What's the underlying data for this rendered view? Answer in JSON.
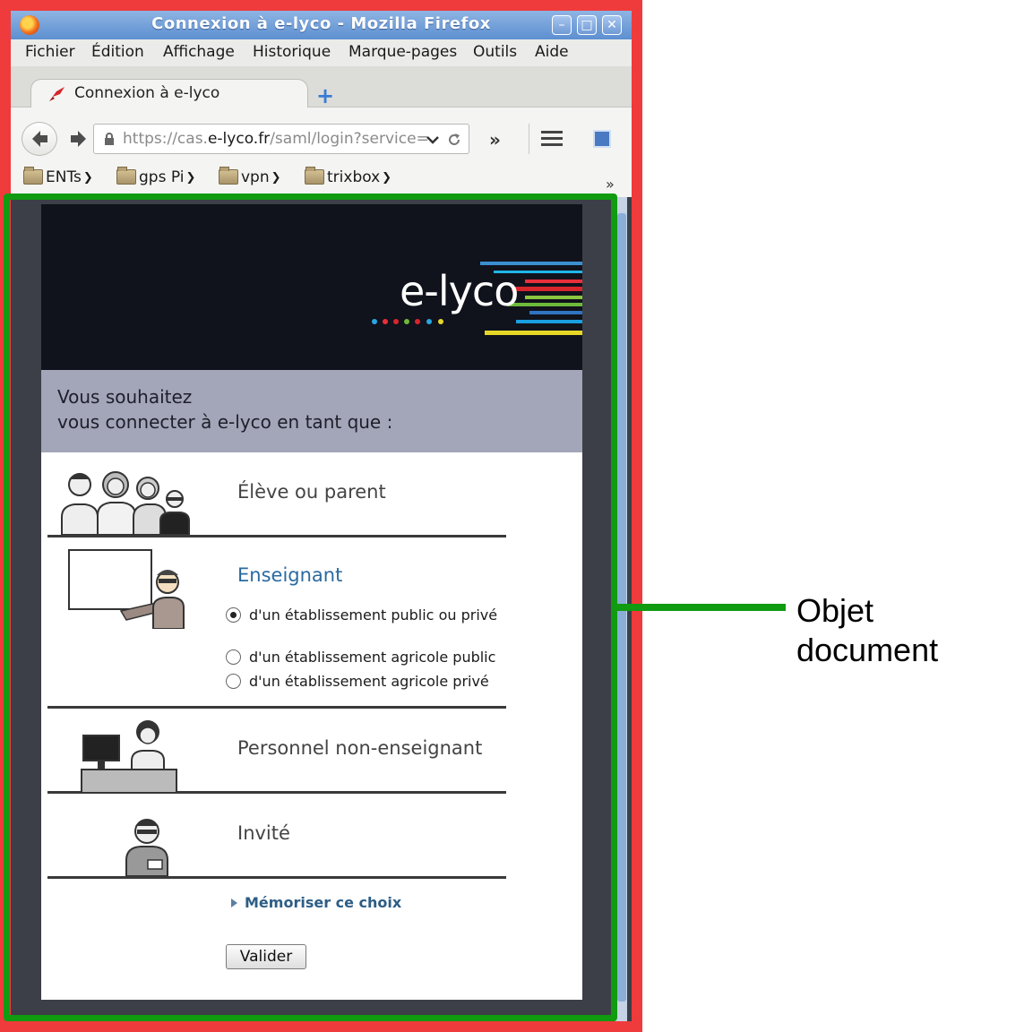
{
  "window": {
    "title": "Connexion à e-lyco - Mozilla Firefox",
    "controls": [
      "minimize",
      "maximize",
      "close"
    ]
  },
  "menubar": {
    "items": [
      "Fichier",
      "Édition",
      "Affichage",
      "Historique",
      "Marque-pages",
      "Outils",
      "Aide"
    ]
  },
  "tab": {
    "title": "Connexion à e-lyco",
    "new_tab": "+"
  },
  "navbar": {
    "url_prefix": "https://cas.",
    "url_domain": "e-lyco.fr",
    "url_suffix": "/saml/login?service=",
    "overflow": "»"
  },
  "bookmarks": {
    "items": [
      "ENTs",
      "gps Pi",
      "vpn",
      "trixbox"
    ],
    "more": "»"
  },
  "page": {
    "logo": "e-lyco",
    "question_line1": "Vous souhaitez",
    "question_line2": "vous connecter à e-lyco en tant que :",
    "roles": {
      "eleve": "Élève ou parent",
      "enseignant": "Enseignant",
      "personnel": "Personnel non-enseignant",
      "invite": "Invité"
    },
    "enseignant_options": [
      {
        "label": "d'un établissement public ou privé",
        "checked": true
      },
      {
        "label": "d'un établissement agricole public",
        "checked": false
      },
      {
        "label": "d'un établissement agricole privé",
        "checked": false
      }
    ],
    "remember": "Mémoriser ce choix",
    "submit": "Valider"
  },
  "annotation": {
    "line1": "Objet",
    "line2": "document"
  },
  "colors": {
    "outer_frame": "#ef3b3b",
    "document_frame": "#109b10",
    "banner": "#10121c",
    "question_band": "#a3a6b8",
    "enseignant_label": "#2a6aa0"
  }
}
